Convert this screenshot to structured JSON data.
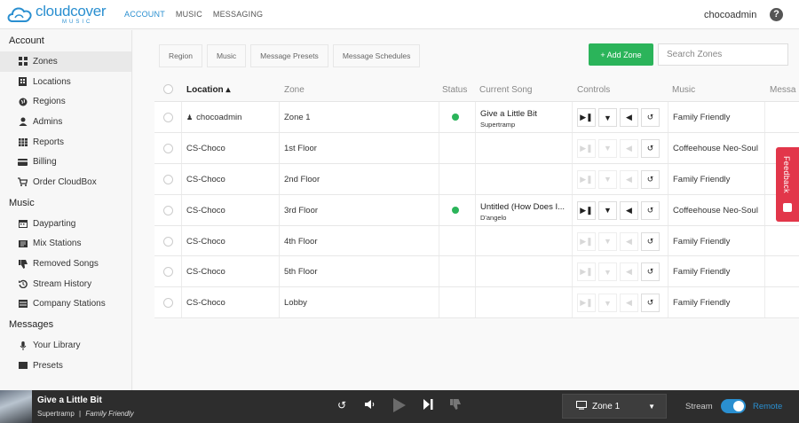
{
  "brand": {
    "name": "cloudcover",
    "tagline": "MUSIC"
  },
  "topnav": [
    {
      "label": "ACCOUNT",
      "active": true
    },
    {
      "label": "MUSIC",
      "active": false
    },
    {
      "label": "MESSAGING",
      "active": false
    }
  ],
  "user": {
    "name": "chocoadmin"
  },
  "help_icon": "question-circle-icon",
  "sidebar": {
    "sections": [
      {
        "title": "Account",
        "items": [
          {
            "label": "Zones",
            "icon": "grid-icon",
            "active": true
          },
          {
            "label": "Locations",
            "icon": "building-icon"
          },
          {
            "label": "Regions",
            "icon": "globe-icon"
          },
          {
            "label": "Admins",
            "icon": "user-icon"
          },
          {
            "label": "Reports",
            "icon": "table-icon"
          },
          {
            "label": "Billing",
            "icon": "credit-card-icon"
          },
          {
            "label": "Order CloudBox",
            "icon": "cart-icon"
          }
        ]
      },
      {
        "title": "Music",
        "items": [
          {
            "label": "Dayparting",
            "icon": "calendar-icon"
          },
          {
            "label": "Mix Stations",
            "icon": "mix-icon"
          },
          {
            "label": "Removed Songs",
            "icon": "thumbs-down-icon"
          },
          {
            "label": "Stream History",
            "icon": "history-icon"
          },
          {
            "label": "Company Stations",
            "icon": "list-icon"
          }
        ]
      },
      {
        "title": "Messages",
        "items": [
          {
            "label": "Your Library",
            "icon": "microphone-icon"
          },
          {
            "label": "Presets",
            "icon": "preset-icon"
          }
        ]
      }
    ]
  },
  "filters": [
    "Region",
    "Music",
    "Message Presets",
    "Message Schedules"
  ],
  "add_zone": {
    "label": "+ Add Zone",
    "color": "#2bb45a"
  },
  "search": {
    "placeholder": "Search Zones"
  },
  "table": {
    "headers": {
      "location": "Location ▴",
      "zone": "Zone",
      "status": "Status",
      "song": "Current Song",
      "controls": "Controls",
      "music": "Music",
      "messages": "Messa"
    },
    "rows": [
      {
        "location": "chocoadmin",
        "owner_icon": true,
        "zone": "Zone 1",
        "playing": true,
        "song": "Give a Little Bit",
        "artist": "Supertramp",
        "music": "Family Friendly"
      },
      {
        "location": "CS-Choco",
        "zone": "1st Floor",
        "playing": false,
        "song": "",
        "artist": "",
        "music": "Coffeehouse Neo-Soul"
      },
      {
        "location": "CS-Choco",
        "zone": "2nd Floor",
        "playing": false,
        "song": "",
        "artist": "",
        "music": "Family Friendly"
      },
      {
        "location": "CS-Choco",
        "zone": "3rd Floor",
        "playing": true,
        "song": "Untitled (How Does I...",
        "artist": "D'angelo",
        "music": "Coffeehouse Neo-Soul"
      },
      {
        "location": "CS-Choco",
        "zone": "4th Floor",
        "playing": false,
        "song": "",
        "artist": "",
        "music": "Family Friendly"
      },
      {
        "location": "CS-Choco",
        "zone": "5th Floor",
        "playing": false,
        "song": "",
        "artist": "",
        "music": "Family Friendly"
      },
      {
        "location": "CS-Choco",
        "zone": "Lobby",
        "playing": false,
        "song": "",
        "artist": "",
        "music": "Family Friendly"
      }
    ]
  },
  "feedback": {
    "label": "Feedback",
    "color": "#e2364a"
  },
  "player": {
    "title": "Give a Little Bit",
    "artist": "Supertramp",
    "station": "Family Friendly",
    "separator": "|",
    "zone": "Zone 1",
    "stream_label": "Stream",
    "remote_label": "Remote",
    "remote_on": true
  },
  "colors": {
    "accent": "#2a8fd0",
    "green": "#2bb45a",
    "dark_bar": "#2d2d2d"
  }
}
